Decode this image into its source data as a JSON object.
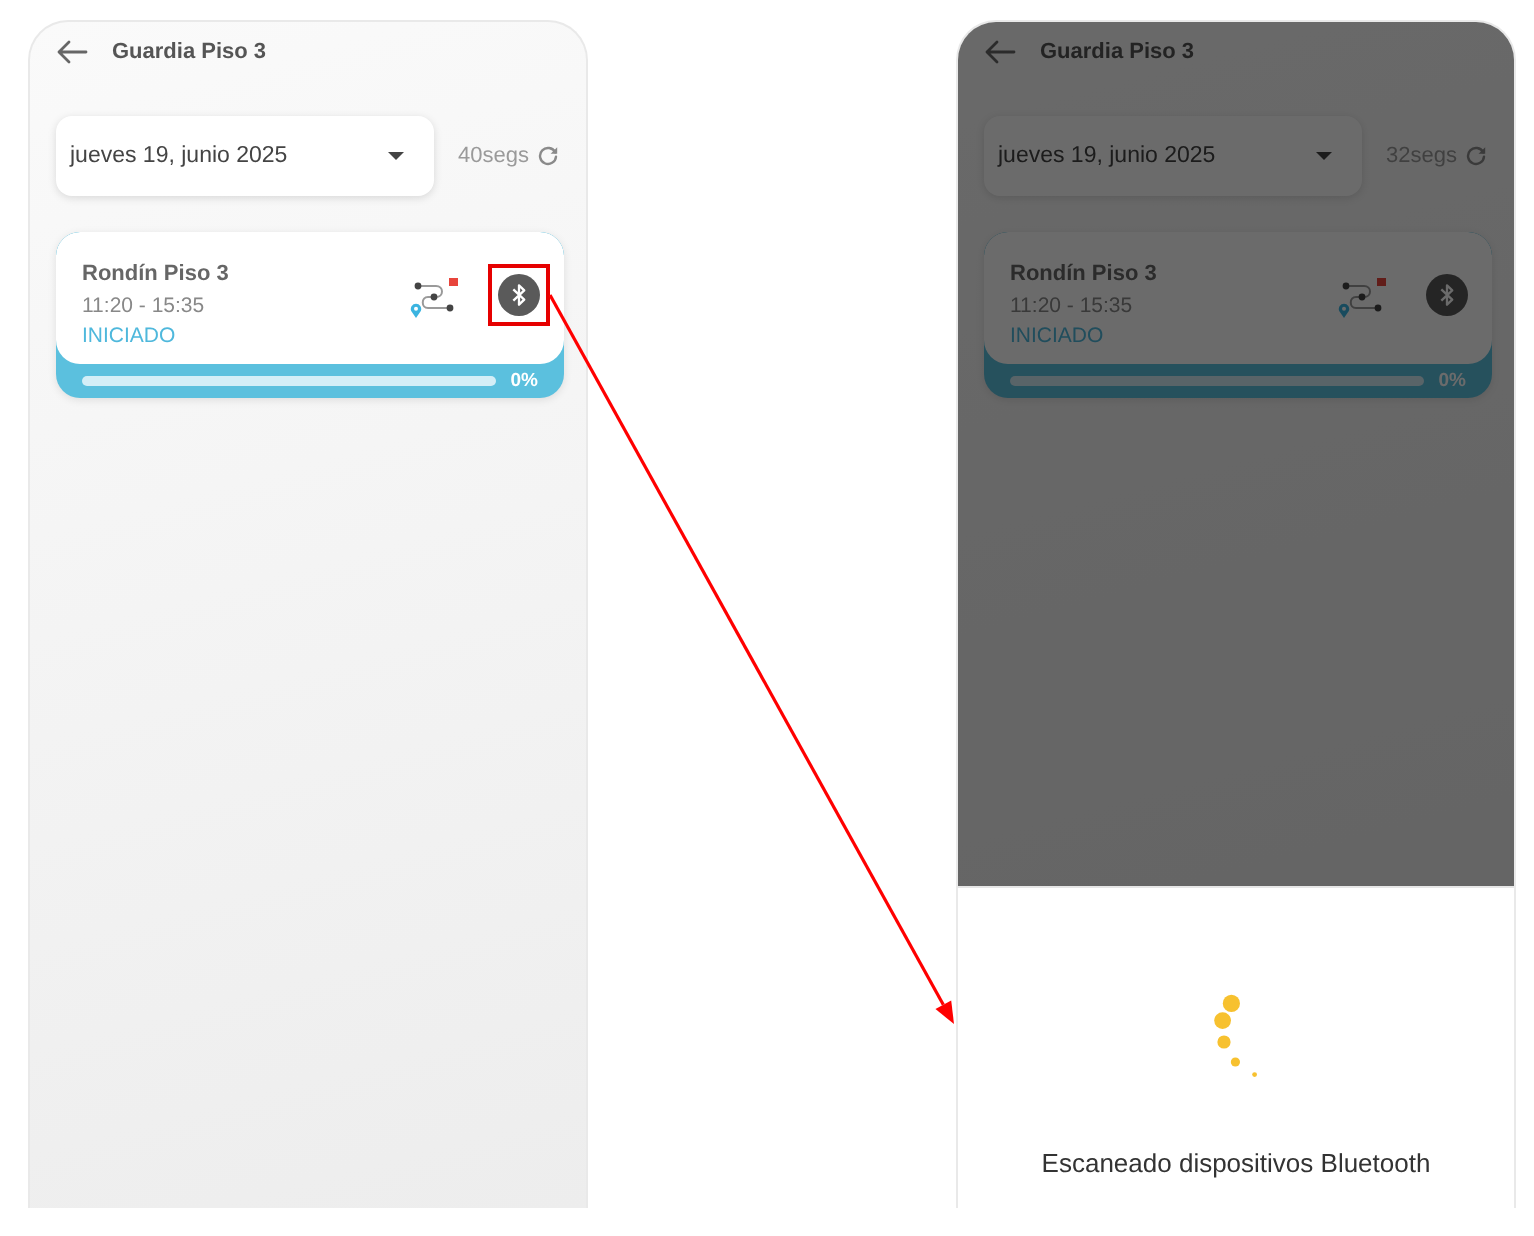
{
  "screens": [
    {
      "dimmed": false,
      "header": {
        "title": "Guardia Piso 3"
      },
      "date_picker": {
        "value": "jueves 19, junio 2025"
      },
      "refresh_countdown": "40segs",
      "rounds": [
        {
          "title": "Rondín Piso 3",
          "time": "11:20 - 15:35",
          "status": "INICIADO",
          "level": 0,
          "progress_label": "0%",
          "highlighted": true
        }
      ]
    },
    {
      "dimmed": true,
      "header": {
        "title": "Guardia Piso 3"
      },
      "date_picker": {
        "value": "jueves 19, junio 2025"
      },
      "refresh_countdown": "32segs",
      "rounds": [
        {
          "title": "Rondín Piso 3",
          "time": "11:20 - 15:35",
          "status": "INICIADO",
          "level": 0,
          "progress_label": "0%",
          "highlighted": false
        }
      ],
      "bottom_sheet": {
        "message": "Escaneado dispositivos Bluetooth"
      }
    }
  ]
}
